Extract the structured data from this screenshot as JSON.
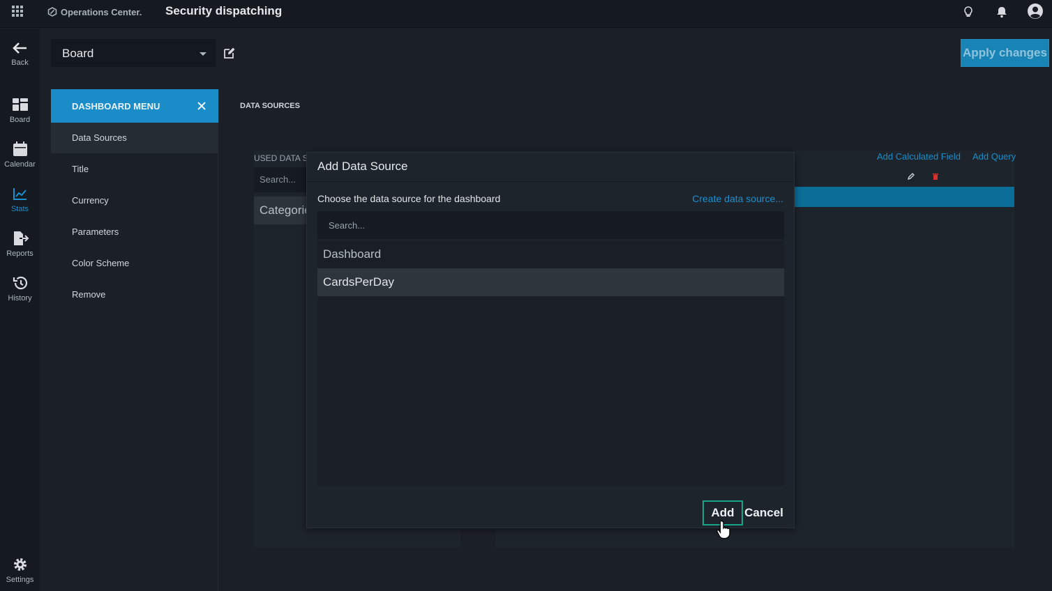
{
  "app": {
    "brand": "Operations Center.",
    "title": "Security dispatching"
  },
  "topbar_icons": [
    "apps-grid-icon",
    "lightbulb-icon",
    "bell-icon",
    "user-avatar-icon"
  ],
  "sidebar": {
    "items": [
      {
        "label": "Back",
        "icon": "arrow-left-icon"
      },
      {
        "label": "Board",
        "icon": "dashboard-icon"
      },
      {
        "label": "Calendar",
        "icon": "calendar-icon"
      },
      {
        "label": "Stats",
        "icon": "line-chart-icon",
        "active": true
      },
      {
        "label": "Reports",
        "icon": "export-icon"
      },
      {
        "label": "History",
        "icon": "history-icon"
      },
      {
        "label": "Settings",
        "icon": "gear-icon"
      }
    ]
  },
  "board_select": {
    "value": "Board"
  },
  "apply_button": "Apply changes",
  "dashboard_menu": {
    "title": "DASHBOARD MENU",
    "items": [
      "Data Sources",
      "Title",
      "Currency",
      "Parameters",
      "Color Scheme",
      "Remove"
    ],
    "selected": "Data Sources"
  },
  "data_sources": {
    "heading": "DATA SOURCES",
    "used_label": "USED DATA S",
    "search_placeholder": "Search...",
    "category_label": "Categorie",
    "add_calculated_field": "Add Calculated Field",
    "add_query": "Add Query"
  },
  "modal": {
    "title": "Add Data Source",
    "subtitle": "Choose the data source for the dashboard",
    "create_link": "Create data source...",
    "search_placeholder": "Search...",
    "options": [
      "Dashboard",
      "CardsPerDay"
    ],
    "selected": "CardsPerDay",
    "add_button": "Add",
    "cancel_button": "Cancel"
  },
  "colors": {
    "accent": "#1a8dc9",
    "danger": "#d9302c",
    "focus_border": "#17a589"
  }
}
